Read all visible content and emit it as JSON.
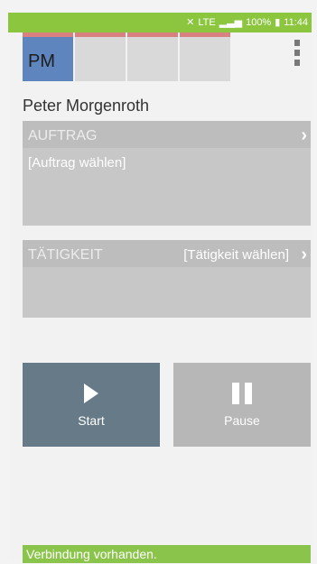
{
  "status_bar": {
    "network": "LTE",
    "battery": "100%",
    "time": "11:44"
  },
  "tabs": [
    {
      "initials": "PM"
    },
    {
      "initials": ""
    },
    {
      "initials": ""
    },
    {
      "initials": ""
    }
  ],
  "user": {
    "name": "Peter Morgenroth"
  },
  "auftrag": {
    "title": "AUFTRAG",
    "value": "[Auftrag wählen]"
  },
  "taetigkeit": {
    "title": "TÄTIGKEIT",
    "select_label": "[Tätigkeit wählen]"
  },
  "buttons": {
    "start_label": "Start",
    "pause_label": "Pause"
  },
  "connection": {
    "message": "Verbindung vorhanden."
  },
  "colors": {
    "accent": "#8cc63f",
    "active_tab": "#5f85bf",
    "start_button": "#667a87",
    "pause_button": "#b7b7b7"
  }
}
